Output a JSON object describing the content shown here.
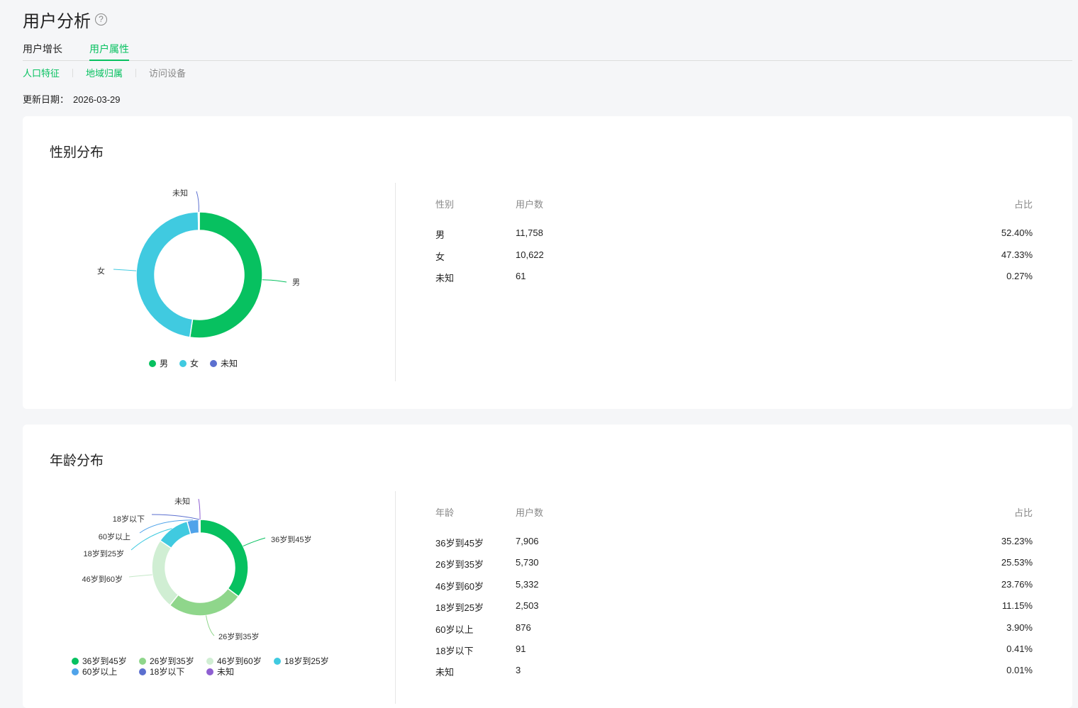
{
  "page": {
    "title": "用户分析",
    "help_icon": "?"
  },
  "tabs": [
    {
      "label": "用户增长"
    },
    {
      "label": "用户属性",
      "active": true
    }
  ],
  "subtabs": [
    {
      "label": "人口特征"
    },
    {
      "label": "地域归属"
    },
    {
      "label": "访问设备"
    }
  ],
  "update": {
    "label": "更新日期：",
    "value": "2026-03-29"
  },
  "gender": {
    "title": "性别分布",
    "headers": [
      "性别",
      "用户数",
      "占比"
    ],
    "rows": [
      {
        "name": "男",
        "count": "11,758",
        "pct": "52.40%",
        "value": 11758,
        "color": "#07c160"
      },
      {
        "name": "女",
        "count": "10,622",
        "pct": "47.33%",
        "value": 10622,
        "color": "#40cae0"
      },
      {
        "name": "未知",
        "count": "61",
        "pct": "0.27%",
        "value": 61,
        "color": "#5b6fcf"
      }
    ]
  },
  "age": {
    "title": "年龄分布",
    "headers": [
      "年龄",
      "用户数",
      "占比"
    ],
    "rows": [
      {
        "name": "36岁到45岁",
        "count": "7,906",
        "pct": "35.23%",
        "value": 7906,
        "color": "#07c160"
      },
      {
        "name": "26岁到35岁",
        "count": "5,730",
        "pct": "25.53%",
        "value": 5730,
        "color": "#8fd68b"
      },
      {
        "name": "46岁到60岁",
        "count": "5,332",
        "pct": "23.76%",
        "value": 5332,
        "color": "#d0eed3"
      },
      {
        "name": "18岁到25岁",
        "count": "2,503",
        "pct": "11.15%",
        "value": 2503,
        "color": "#40cae0"
      },
      {
        "name": "60岁以上",
        "count": "876",
        "pct": "3.90%",
        "value": 876,
        "color": "#4fa3ea"
      },
      {
        "name": "18岁以下",
        "count": "91",
        "pct": "0.41%",
        "value": 91,
        "color": "#5b6fcf"
      },
      {
        "name": "未知",
        "count": "3",
        "pct": "0.01%",
        "value": 3,
        "color": "#8e5fd1"
      }
    ]
  }
}
